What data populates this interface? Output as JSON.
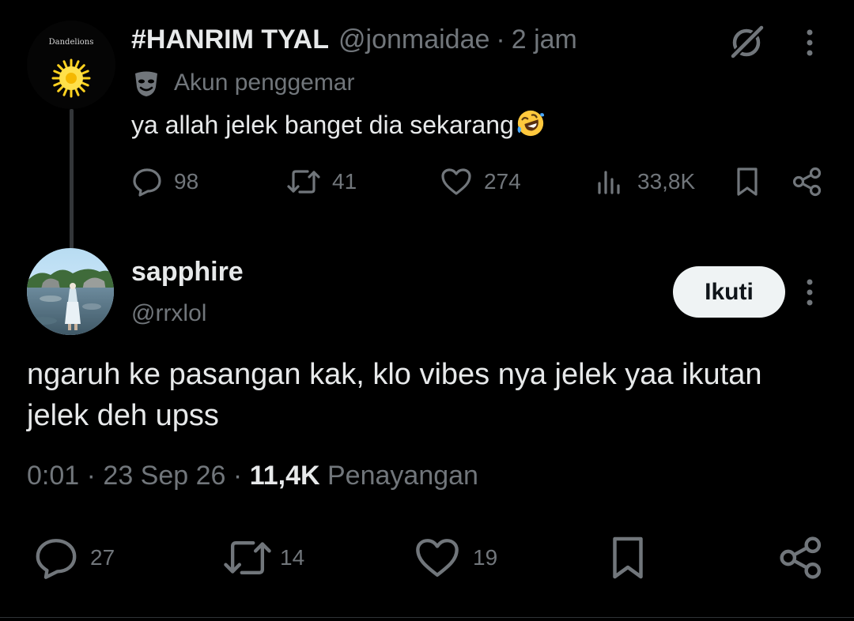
{
  "parent_tweet": {
    "avatar_text": "Dandelions",
    "display_name": "#HANRIM TYAL",
    "handle": "@jonmaidae",
    "separator": "·",
    "time": "2 jam",
    "account_label": "Akun penggemar",
    "text": "ya allah jelek banget dia sekarang",
    "emoji": "rolling-on-the-floor-laughing-emoji",
    "replies": "98",
    "reposts": "41",
    "likes": "274",
    "views": "33,8K"
  },
  "reply_tweet": {
    "display_name": "sapphire",
    "handle": "@rrxlol",
    "follow_label": "Ikuti",
    "text": "ngaruh ke pasangan kak, klo vibes nya jelek yaa ikutan jelek deh upss",
    "time": "0:01",
    "dot": "·",
    "date": "23 Sep 26",
    "views_count": "11,4K",
    "views_label": "Penayangan",
    "replies": "27",
    "reposts": "14",
    "likes": "19"
  },
  "colors": {
    "background": "#000000",
    "primary_text": "#e7e9ea",
    "secondary_text": "#71767b",
    "thread_line": "#333639",
    "follow_button_bg": "#eff3f4"
  }
}
